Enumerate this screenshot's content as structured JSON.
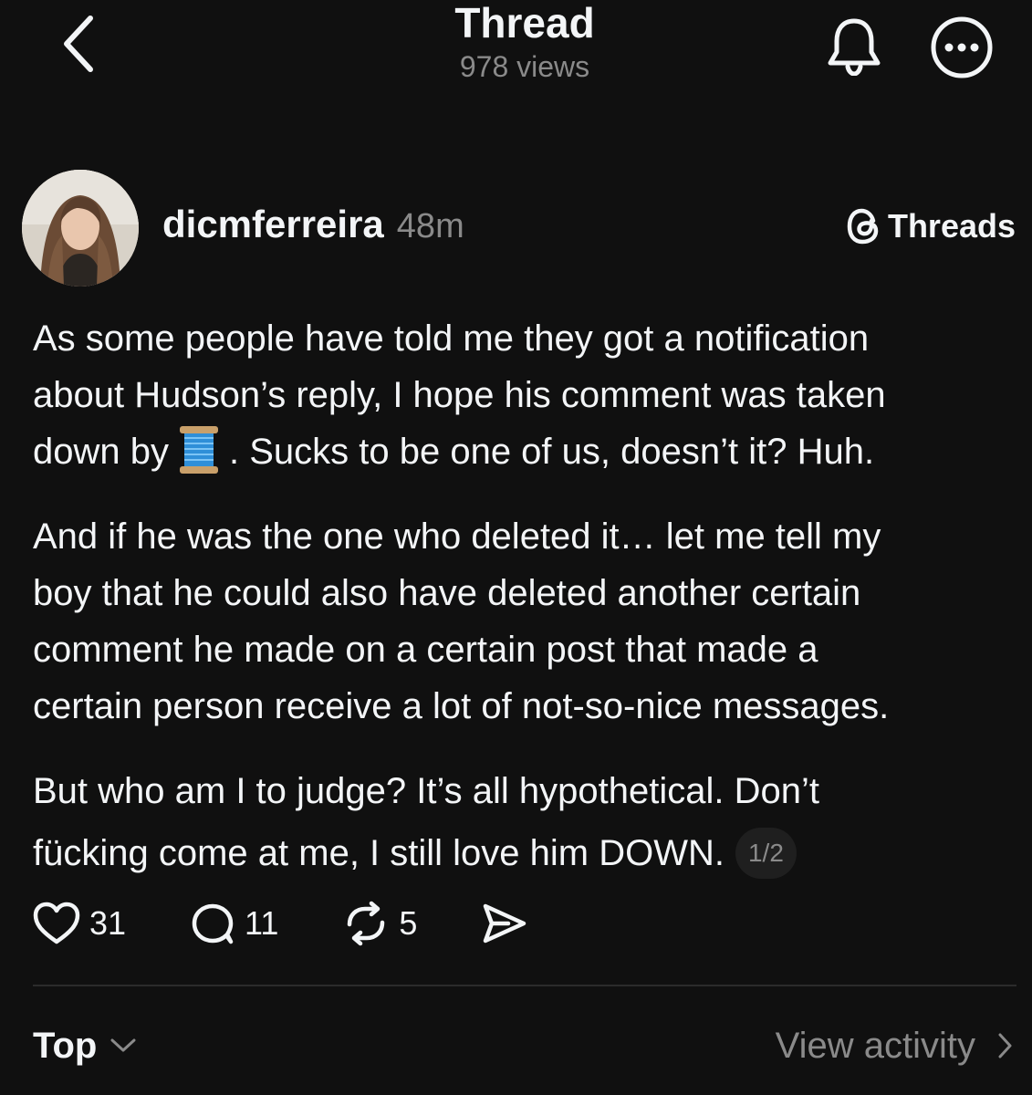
{
  "header": {
    "title": "Thread",
    "views": "978 views",
    "back_icon": "chevron-left-icon",
    "bell_icon": "bell-icon",
    "more_icon": "more-circle-icon"
  },
  "post": {
    "username": "dicmferreira",
    "timestamp": "48m",
    "source_label": "Threads",
    "paragraph1_part1": "As some people have told me they got a notification",
    "paragraph1_part2": "about Hudson’s reply, I hope his comment was taken",
    "paragraph1_part3": "down by",
    "paragraph1_part4": ". Sucks to be one of us, doesn’t it? Huh.",
    "paragraph2_line1": "And if he was the one who deleted it… let me tell my",
    "paragraph2_line2": "boy that he could also have deleted another certain",
    "paragraph2_line3": "comment he made on a certain post that made a",
    "paragraph2_line4": "certain person receive a lot of not-so-nice messages.",
    "paragraph3_line1": "But who am I to judge? It’s all hypothetical. Don’t",
    "paragraph3_line2": "fücking come at me, I still love him DOWN.",
    "page_indicator": "1/2"
  },
  "actions": {
    "likes": "31",
    "replies": "11",
    "reposts": "5"
  },
  "footer": {
    "sort_label": "Top",
    "activity_label": "View activity"
  },
  "colors": {
    "background": "#101010",
    "text": "#f3f5f7",
    "secondary": "#8a8a8a"
  }
}
